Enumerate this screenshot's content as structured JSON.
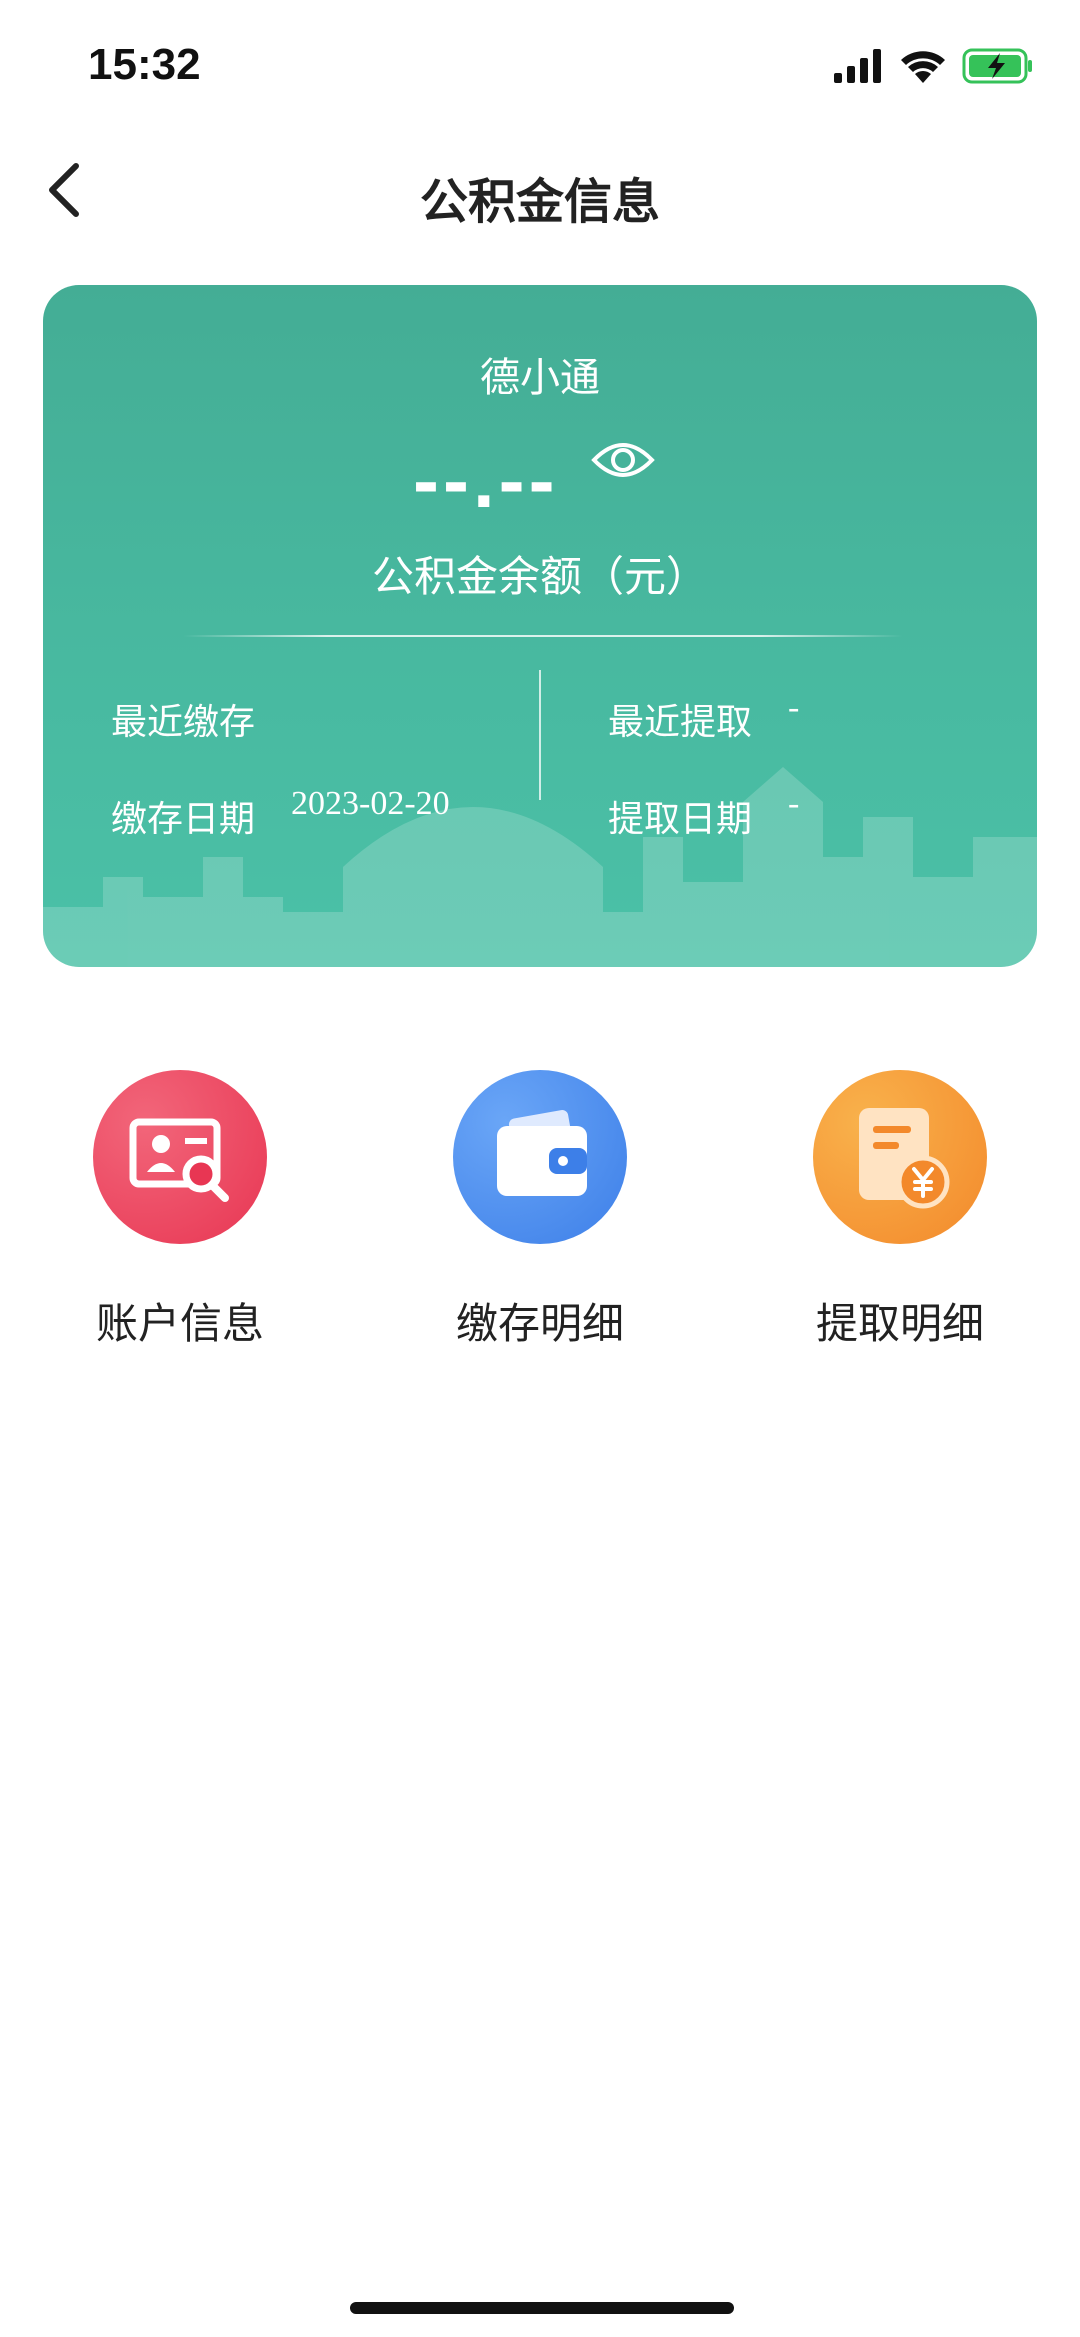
{
  "status_bar": {
    "time": "15:32",
    "icons": [
      "signal-icon",
      "wifi-icon",
      "battery-charging-icon"
    ]
  },
  "nav": {
    "title": "公积金信息",
    "back_icon": "chevron-left-icon"
  },
  "card": {
    "user_name": "德小通",
    "balance": "--.--",
    "balance_label": "公积金余额（元）",
    "recent_deposit_label": "最近缴存",
    "recent_deposit_value": "",
    "deposit_date_label": "缴存日期",
    "deposit_date_value": "2023-02-20",
    "recent_withdraw_label": "最近提取",
    "recent_withdraw_value": "-",
    "withdraw_date_label": "提取日期",
    "withdraw_date_value": "-",
    "colors": {
      "card_top": "#44ad95",
      "card_bottom": "#4bc1a7"
    }
  },
  "actions": [
    {
      "label": "账户信息",
      "icon": "account-search-icon",
      "color": "#ef4560"
    },
    {
      "label": "缴存明细",
      "icon": "wallet-icon",
      "color": "#4f8ff0"
    },
    {
      "label": "提取明细",
      "icon": "bill-yen-icon",
      "color": "#f59a38"
    }
  ]
}
